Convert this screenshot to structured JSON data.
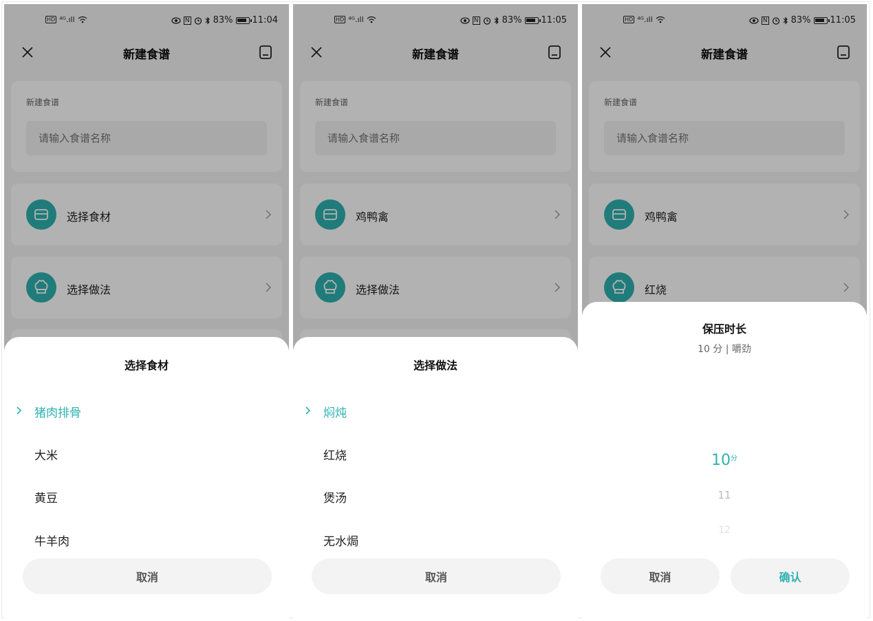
{
  "colors": {
    "accent": "#2fb2b0",
    "text": "#222222",
    "muted": "#666666"
  },
  "status": {
    "hd": "HD",
    "signal": "⁴ᴳ.ıll",
    "nfc": "N",
    "battery": "83%",
    "screens": [
      {
        "time": "11:04"
      },
      {
        "time": "11:05"
      },
      {
        "time": "11:05"
      }
    ]
  },
  "page": {
    "title": "新建食谱",
    "name_label": "新建食谱",
    "name_placeholder": "请输入食谱名称"
  },
  "screens": [
    {
      "ingredient_row": "选择食材",
      "method_row": "选择做法",
      "sheet": {
        "title": "选择食材",
        "options": [
          "猪肉排骨",
          "大米",
          "黄豆",
          "牛羊肉"
        ],
        "cancel": "取消"
      }
    },
    {
      "ingredient_row": "鸡鸭禽",
      "method_row": "选择做法",
      "sheet": {
        "title": "选择做法",
        "options": [
          "焖炖",
          "红烧",
          "煲汤",
          "无水焗"
        ],
        "cancel": "取消"
      }
    },
    {
      "ingredient_row": "鸡鸭禽",
      "method_row": "红烧",
      "sheet": {
        "title": "保压时长",
        "subtitle": "10 分 |  嚼劲",
        "picker": {
          "selected": "10",
          "unit": "分",
          "next": "11",
          "after": "12"
        },
        "cancel": "取消",
        "confirm": "确认"
      }
    }
  ]
}
